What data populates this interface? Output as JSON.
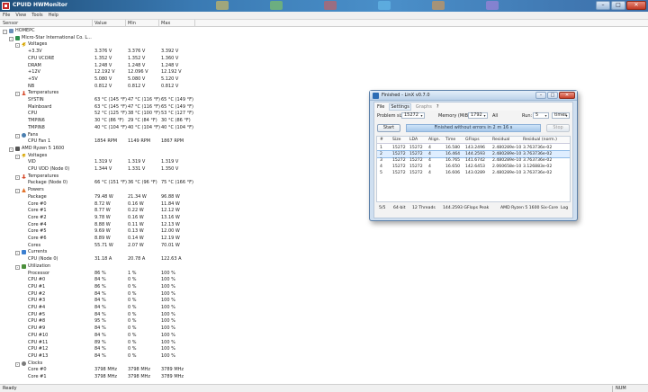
{
  "window": {
    "title": "CPUID HWMonitor"
  },
  "menu": [
    "File",
    "View",
    "Tools",
    "Help"
  ],
  "columns": {
    "sensor": "Sensor",
    "value": "Value",
    "min": "Min",
    "max": "Max"
  },
  "tree": [
    {
      "indent": 0,
      "exp": "-",
      "icon": "pc",
      "label": "HOMEPC"
    },
    {
      "indent": 1,
      "exp": "-",
      "icon": "board",
      "label": "Micro-Star International Co. L..."
    },
    {
      "indent": 2,
      "exp": "-",
      "icon": "volt",
      "label": "Voltages"
    },
    {
      "indent": 3,
      "label": "+3.3V",
      "value": "3.376 V",
      "min": "3.376 V",
      "max": "3.392 V"
    },
    {
      "indent": 3,
      "label": "CPU VCORE",
      "value": "1.352 V",
      "min": "1.352 V",
      "max": "1.360 V"
    },
    {
      "indent": 3,
      "label": "DRAM",
      "value": "1.248 V",
      "min": "1.248 V",
      "max": "1.248 V"
    },
    {
      "indent": 3,
      "label": "+12V",
      "value": "12.192 V",
      "min": "12.096 V",
      "max": "12.192 V"
    },
    {
      "indent": 3,
      "label": "+5V",
      "value": "5.080 V",
      "min": "5.080 V",
      "max": "5.120 V"
    },
    {
      "indent": 3,
      "label": "NB",
      "value": "0.812 V",
      "min": "0.812 V",
      "max": "0.812 V"
    },
    {
      "indent": 2,
      "exp": "-",
      "icon": "temp",
      "label": "Temperatures"
    },
    {
      "indent": 3,
      "label": "SYSTIN",
      "value": "63 °C  (145 °F)",
      "min": "47 °C  (116 °F)",
      "max": "65 °C  (149 °F)"
    },
    {
      "indent": 3,
      "label": "Mainboard",
      "value": "63 °C  (145 °F)",
      "min": "47 °C  (116 °F)",
      "max": "65 °C  (149 °F)"
    },
    {
      "indent": 3,
      "label": "CPU",
      "value": "52 °C  (125 °F)",
      "min": "38 °C  (100 °F)",
      "max": "53 °C  (127 °F)"
    },
    {
      "indent": 3,
      "label": "TMPIN6",
      "value": "30 °C  (86 °F)",
      "min": "29 °C  (84 °F)",
      "max": "30 °C  (86 °F)"
    },
    {
      "indent": 3,
      "label": "TMPIN8",
      "value": "40 °C  (104 °F)",
      "min": "40 °C  (104 °F)",
      "max": "40 °C  (104 °F)"
    },
    {
      "indent": 2,
      "exp": "-",
      "icon": "fan",
      "label": "Fans"
    },
    {
      "indent": 3,
      "label": "CPU Fan 1",
      "value": "1854 RPM",
      "min": "1149 RPM",
      "max": "1867 RPM"
    },
    {
      "indent": 1,
      "exp": "-",
      "icon": "cpu",
      "label": "AMD Ryzen 5 1600"
    },
    {
      "indent": 2,
      "exp": "-",
      "icon": "volt",
      "label": "Voltages"
    },
    {
      "indent": 3,
      "label": "VID",
      "value": "1.319 V",
      "min": "1.319 V",
      "max": "1.319 V"
    },
    {
      "indent": 3,
      "label": "CPU VDD (Node 0)",
      "value": "1.344 V",
      "min": "1.331 V",
      "max": "1.350 V"
    },
    {
      "indent": 2,
      "exp": "-",
      "icon": "temp",
      "label": "Temperatures"
    },
    {
      "indent": 3,
      "label": "Package (Node 0)",
      "value": "66 °C  (151 °F)",
      "min": "36 °C  (96 °F)",
      "max": "75 °C  (166 °F)"
    },
    {
      "indent": 2,
      "exp": "-",
      "icon": "power",
      "label": "Powers"
    },
    {
      "indent": 3,
      "label": "Package",
      "value": "79.48 W",
      "min": "21.34 W",
      "max": "96.88 W"
    },
    {
      "indent": 3,
      "label": "Core #0",
      "value": "8.72 W",
      "min": "0.16 W",
      "max": "11.84 W"
    },
    {
      "indent": 3,
      "label": "Core #1",
      "value": "8.77 W",
      "min": "0.22 W",
      "max": "12.12 W"
    },
    {
      "indent": 3,
      "label": "Core #2",
      "value": "9.78 W",
      "min": "0.16 W",
      "max": "13.16 W"
    },
    {
      "indent": 3,
      "label": "Core #4",
      "value": "8.88 W",
      "min": "0.11 W",
      "max": "12.13 W"
    },
    {
      "indent": 3,
      "label": "Core #5",
      "value": "9.69 W",
      "min": "0.13 W",
      "max": "12.00 W"
    },
    {
      "indent": 3,
      "label": "Core #6",
      "value": "8.89 W",
      "min": "0.14 W",
      "max": "12.19 W"
    },
    {
      "indent": 3,
      "label": "Cores",
      "value": "55.71 W",
      "min": "2.07 W",
      "max": "70.01 W"
    },
    {
      "indent": 2,
      "exp": "-",
      "icon": "current",
      "label": "Currents"
    },
    {
      "indent": 3,
      "label": "CPU (Node 0)",
      "value": "31.18 A",
      "min": "20.78 A",
      "max": "122.63 A"
    },
    {
      "indent": 2,
      "exp": "-",
      "icon": "util",
      "label": "Utilization"
    },
    {
      "indent": 3,
      "label": "Processor",
      "value": "86 %",
      "min": "1 %",
      "max": "100 %"
    },
    {
      "indent": 3,
      "label": "CPU #0",
      "value": "84 %",
      "min": "0 %",
      "max": "100 %"
    },
    {
      "indent": 3,
      "label": "CPU #1",
      "value": "86 %",
      "min": "0 %",
      "max": "100 %"
    },
    {
      "indent": 3,
      "label": "CPU #2",
      "value": "84 %",
      "min": "0 %",
      "max": "100 %"
    },
    {
      "indent": 3,
      "label": "CPU #3",
      "value": "84 %",
      "min": "0 %",
      "max": "100 %"
    },
    {
      "indent": 3,
      "label": "CPU #4",
      "value": "84 %",
      "min": "0 %",
      "max": "100 %"
    },
    {
      "indent": 3,
      "label": "CPU #5",
      "value": "84 %",
      "min": "0 %",
      "max": "100 %"
    },
    {
      "indent": 3,
      "label": "CPU #8",
      "value": "95 %",
      "min": "0 %",
      "max": "100 %"
    },
    {
      "indent": 3,
      "label": "CPU #9",
      "value": "84 %",
      "min": "0 %",
      "max": "100 %"
    },
    {
      "indent": 3,
      "label": "CPU #10",
      "value": "84 %",
      "min": "0 %",
      "max": "100 %"
    },
    {
      "indent": 3,
      "label": "CPU #11",
      "value": "89 %",
      "min": "0 %",
      "max": "100 %"
    },
    {
      "indent": 3,
      "label": "CPU #12",
      "value": "84 %",
      "min": "0 %",
      "max": "100 %"
    },
    {
      "indent": 3,
      "label": "CPU #13",
      "value": "84 %",
      "min": "0 %",
      "max": "100 %"
    },
    {
      "indent": 2,
      "exp": "-",
      "icon": "clock",
      "label": "Clocks"
    },
    {
      "indent": 3,
      "label": "Core #0",
      "value": "3798 MHz",
      "min": "3798 MHz",
      "max": "3789 MHz"
    },
    {
      "indent": 3,
      "label": "Core #1",
      "value": "3798 MHz",
      "min": "3798 MHz",
      "max": "3789 MHz"
    }
  ],
  "status": {
    "left": "Ready",
    "right": "NUM"
  },
  "linx": {
    "title": "Finished - LinX v0.7.0",
    "menu": [
      "File",
      "Settings",
      "Graphs",
      "?"
    ],
    "problem_size_label": "Problem size:",
    "problem_size": "15272",
    "memory_label": "Memory (MiB):",
    "memory": "1792",
    "memory_option": "All",
    "run_label": "Run:",
    "run_count": "5",
    "run_unit": "times",
    "start_label": "Start",
    "stop_label": "Stop",
    "status_text": "Finished without errors in 2 m 16 s",
    "headers": [
      "#",
      "Size",
      "LDA",
      "Align.",
      "Time",
      "GFlops",
      "Residual",
      "Residual (norm.)"
    ],
    "rows": [
      [
        "1",
        "15272",
        "15272",
        "4",
        "16.580",
        "143.2496",
        "2.480289e-10",
        "3.763736e-02"
      ],
      [
        "2",
        "15272",
        "15272",
        "4",
        "16.464",
        "144.2593",
        "2.480289e-10",
        "3.763736e-02"
      ],
      [
        "3",
        "15272",
        "15272",
        "4",
        "16.765",
        "141.6742",
        "2.480289e-10",
        "3.763736e-02"
      ],
      [
        "4",
        "15272",
        "15272",
        "4",
        "16.650",
        "142.6453",
        "2.060658e-10",
        "3.126883e-02"
      ],
      [
        "5",
        "15272",
        "15272",
        "4",
        "16.606",
        "143.0289",
        "2.480289e-10",
        "3.763736e-02"
      ]
    ],
    "selected_row": 1,
    "footer": {
      "runs": "5/5",
      "bits": "64-bit",
      "threads": "12 Threads",
      "peak": "144.2593 GFlops Peak",
      "cpu": "AMD Ryzen 5 1600 Six-Core",
      "log": "Log"
    }
  }
}
